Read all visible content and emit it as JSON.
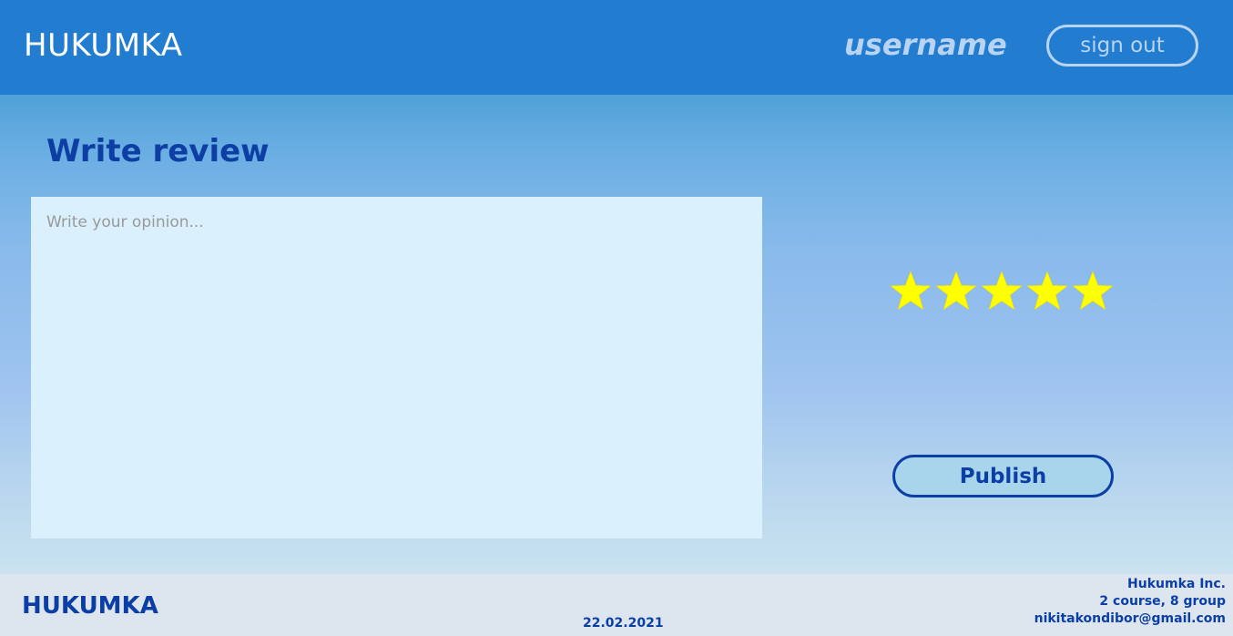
{
  "header": {
    "logo": "HUKUMKA",
    "username": "username",
    "signout_label": "sign out"
  },
  "main": {
    "title": "Write review",
    "review_placeholder": "Write your opinion...",
    "review_value": "",
    "rating": {
      "value": 5,
      "max": 5,
      "star_color": "#ffff00"
    },
    "publish_label": "Publish"
  },
  "footer": {
    "logo": "HUKUMKA",
    "date": "22.02.2021",
    "company": "Hukumka Inc.",
    "group": "2 course, 8 group",
    "email": "nikitakondibor@gmail.com"
  },
  "colors": {
    "header_bg": "#227ccf",
    "accent_dark": "#0b3fa6",
    "text_light": "#b9d3f3"
  }
}
